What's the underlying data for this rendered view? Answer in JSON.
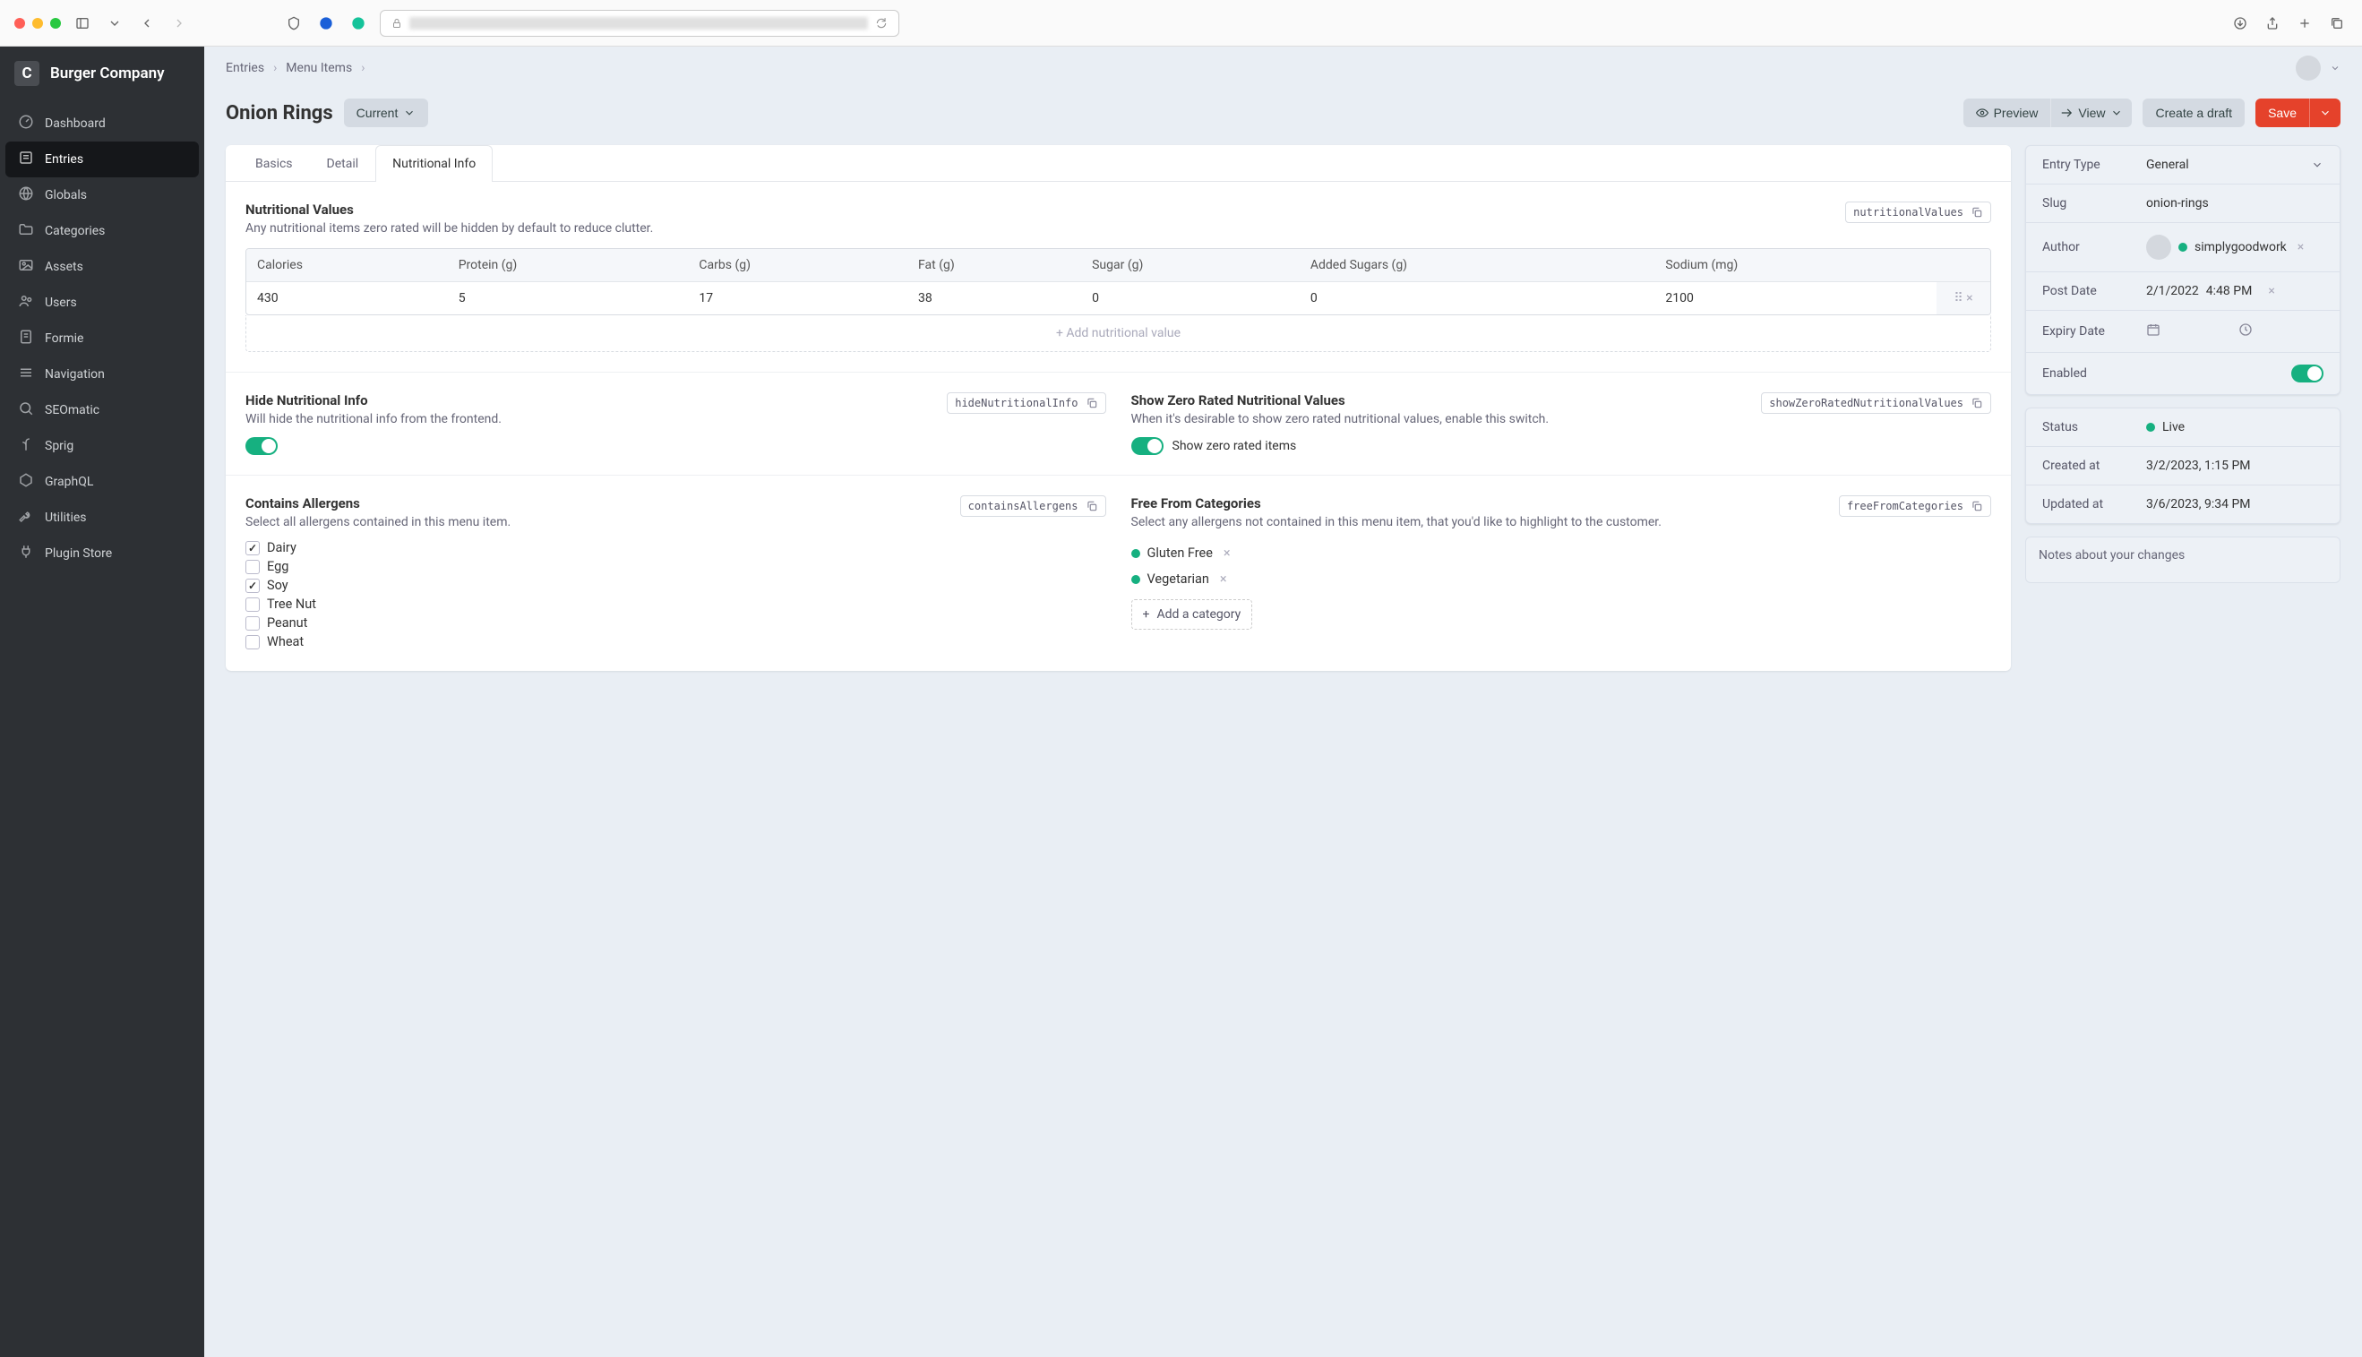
{
  "brand": {
    "badge": "C",
    "name": "Burger Company"
  },
  "sidebar": {
    "items": [
      {
        "label": "Dashboard",
        "icon": "gauge"
      },
      {
        "label": "Entries",
        "icon": "entries",
        "active": true
      },
      {
        "label": "Globals",
        "icon": "globe"
      },
      {
        "label": "Categories",
        "icon": "folder"
      },
      {
        "label": "Assets",
        "icon": "image"
      },
      {
        "label": "Users",
        "icon": "users"
      },
      {
        "label": "Formie",
        "icon": "form"
      },
      {
        "label": "Navigation",
        "icon": "nav"
      },
      {
        "label": "SEOmatic",
        "icon": "seo"
      },
      {
        "label": "Sprig",
        "icon": "sprig"
      },
      {
        "label": "GraphQL",
        "icon": "graphql"
      },
      {
        "label": "Utilities",
        "icon": "wrench"
      },
      {
        "label": "Plugin Store",
        "icon": "plug"
      }
    ]
  },
  "breadcrumbs": [
    "Entries",
    "Menu Items"
  ],
  "page_title": "Onion Rings",
  "revision_label": "Current",
  "header_buttons": {
    "preview": "Preview",
    "view": "View",
    "draft": "Create a draft",
    "save": "Save"
  },
  "tabs": [
    "Basics",
    "Detail",
    "Nutritional Info"
  ],
  "active_tab": 2,
  "nutritional_values": {
    "title": "Nutritional Values",
    "handle": "nutritionalValues",
    "desc": "Any nutritional items zero rated will be hidden by default to reduce clutter.",
    "columns": [
      "Calories",
      "Protein (g)",
      "Carbs (g)",
      "Fat (g)",
      "Sugar (g)",
      "Added Sugars (g)",
      "Sodium (mg)"
    ],
    "rows": [
      [
        "430",
        "5",
        "17",
        "38",
        "0",
        "0",
        "2100"
      ]
    ],
    "add_label": "Add nutritional value"
  },
  "hide_info": {
    "title": "Hide Nutritional Info",
    "handle": "hideNutritionalInfo",
    "desc": "Will hide the nutritional info from the frontend.",
    "enabled": true
  },
  "show_zero": {
    "title": "Show Zero Rated Nutritional Values",
    "handle": "showZeroRatedNutritionalValues",
    "desc": "When it's desirable to show zero rated nutritional values, enable this switch.",
    "enabled": true,
    "toggle_label": "Show zero rated items"
  },
  "allergens": {
    "title": "Contains Allergens",
    "handle": "containsAllergens",
    "desc": "Select all allergens contained in this menu item.",
    "options": [
      {
        "label": "Dairy",
        "checked": true
      },
      {
        "label": "Egg",
        "checked": false
      },
      {
        "label": "Soy",
        "checked": true
      },
      {
        "label": "Tree Nut",
        "checked": false
      },
      {
        "label": "Peanut",
        "checked": false
      },
      {
        "label": "Wheat",
        "checked": false
      }
    ]
  },
  "free_from": {
    "title": "Free From Categories",
    "handle": "freeFromCategories",
    "desc": "Select any allergens not contained in this menu item, that you'd like to highlight to the customer.",
    "items": [
      "Gluten Free",
      "Vegetarian"
    ],
    "add_label": "Add a category"
  },
  "meta": {
    "entry_type": {
      "label": "Entry Type",
      "value": "General"
    },
    "slug": {
      "label": "Slug",
      "value": "onion-rings"
    },
    "author": {
      "label": "Author",
      "value": "simplygoodwork"
    },
    "post_date": {
      "label": "Post Date",
      "date": "2/1/2022",
      "time": "4:48 PM"
    },
    "expiry_date": {
      "label": "Expiry Date"
    },
    "enabled": {
      "label": "Enabled",
      "value": true
    }
  },
  "meta2": {
    "status": {
      "label": "Status",
      "value": "Live"
    },
    "created": {
      "label": "Created at",
      "value": "3/2/2023, 1:15 PM"
    },
    "updated": {
      "label": "Updated at",
      "value": "3/6/2023, 9:34 PM"
    }
  },
  "notes_placeholder": "Notes about your changes"
}
